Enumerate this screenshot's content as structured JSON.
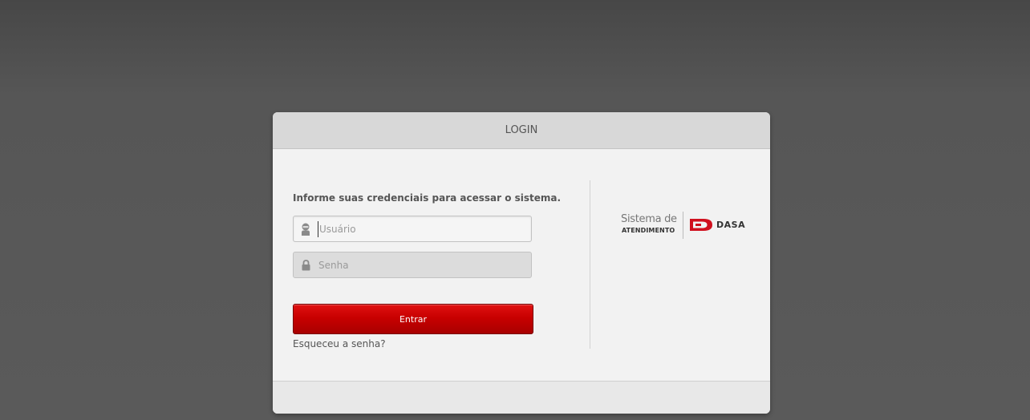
{
  "panel": {
    "title": "LOGIN",
    "instructions": "Informe suas credenciais para acessar o sistema."
  },
  "form": {
    "username_placeholder": "Usuário",
    "username_value": "",
    "password_placeholder": "Senha",
    "password_value": "",
    "submit_label": "Entrar",
    "forgot_label": "Esqueceu a senha?"
  },
  "icons": {
    "username": "user-icon",
    "password": "lock-icon"
  },
  "brand": {
    "line1": "Sistema de",
    "line2": "ATENDIMENTO",
    "company": "DASA"
  },
  "colors": {
    "accent": "#c80000",
    "brand_red": "#d0101e"
  }
}
